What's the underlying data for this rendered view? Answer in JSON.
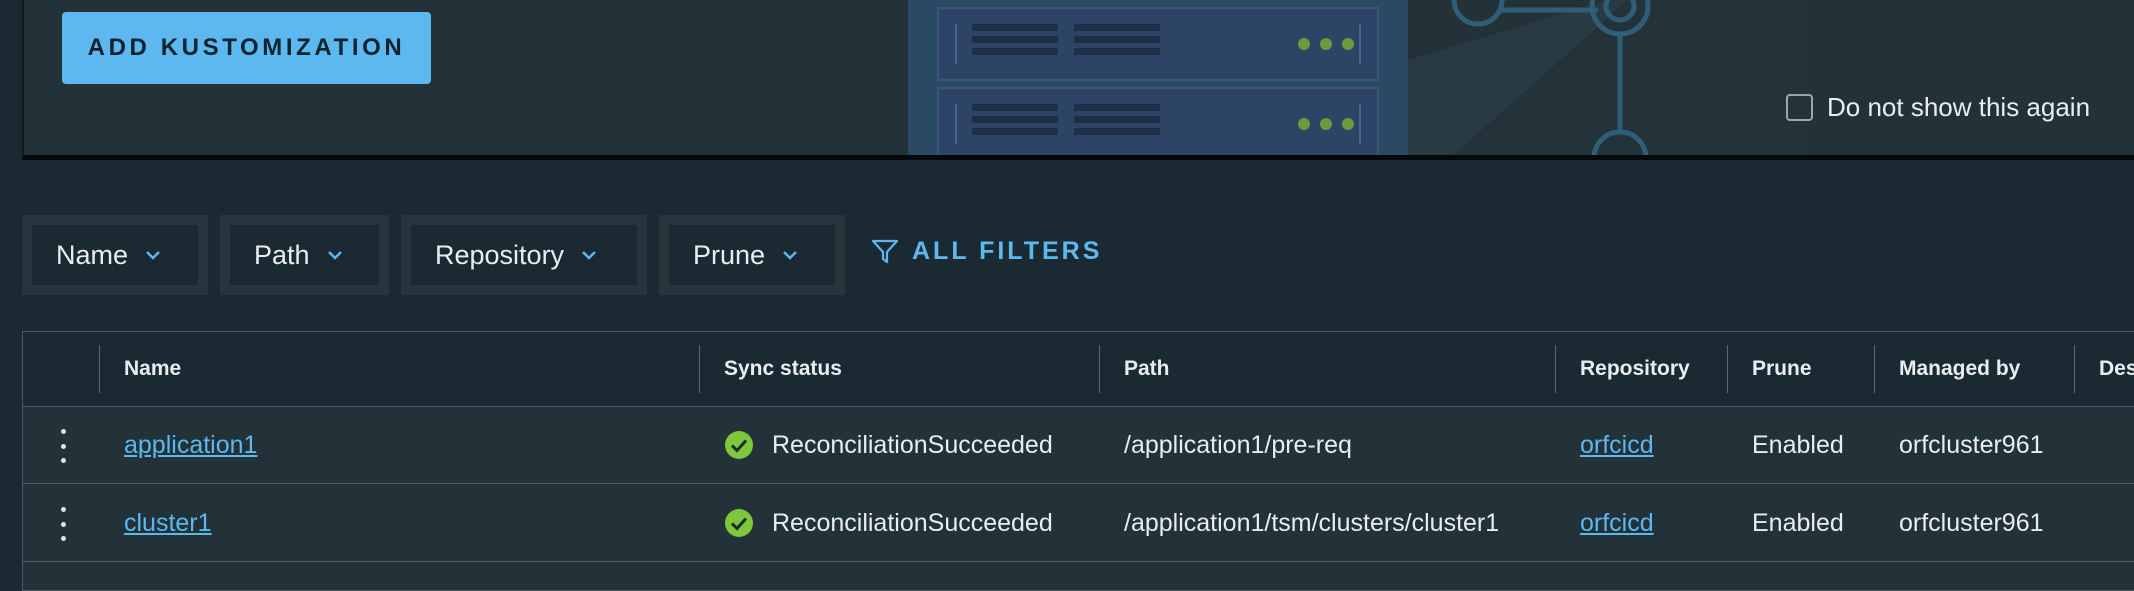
{
  "banner": {
    "add_button_label": "ADD KUSTOMIZATION",
    "dont_show_label": "Do not show this again"
  },
  "filters": {
    "items": [
      {
        "label": "Name"
      },
      {
        "label": "Path"
      },
      {
        "label": "Repository"
      },
      {
        "label": "Prune"
      }
    ],
    "all_filters_label": "ALL FILTERS"
  },
  "table": {
    "columns": [
      "Name",
      "Sync status",
      "Path",
      "Repository",
      "Prune",
      "Managed by",
      "Des"
    ],
    "rows": [
      {
        "name": "application1",
        "sync_status": "ReconciliationSucceeded",
        "path": "/application1/pre-req",
        "repository": "orfcicd",
        "prune": "Enabled",
        "managed_by": "orfcluster961"
      },
      {
        "name": "cluster1",
        "sync_status": "ReconciliationSucceeded",
        "path": "/application1/tsm/clusters/cluster1",
        "repository": "orfcicd",
        "prune": "Enabled",
        "managed_by": "orfcluster961"
      }
    ]
  },
  "colors": {
    "background": "#1b2a32",
    "accent": "#5cb8ee",
    "success": "#7ec63a"
  }
}
